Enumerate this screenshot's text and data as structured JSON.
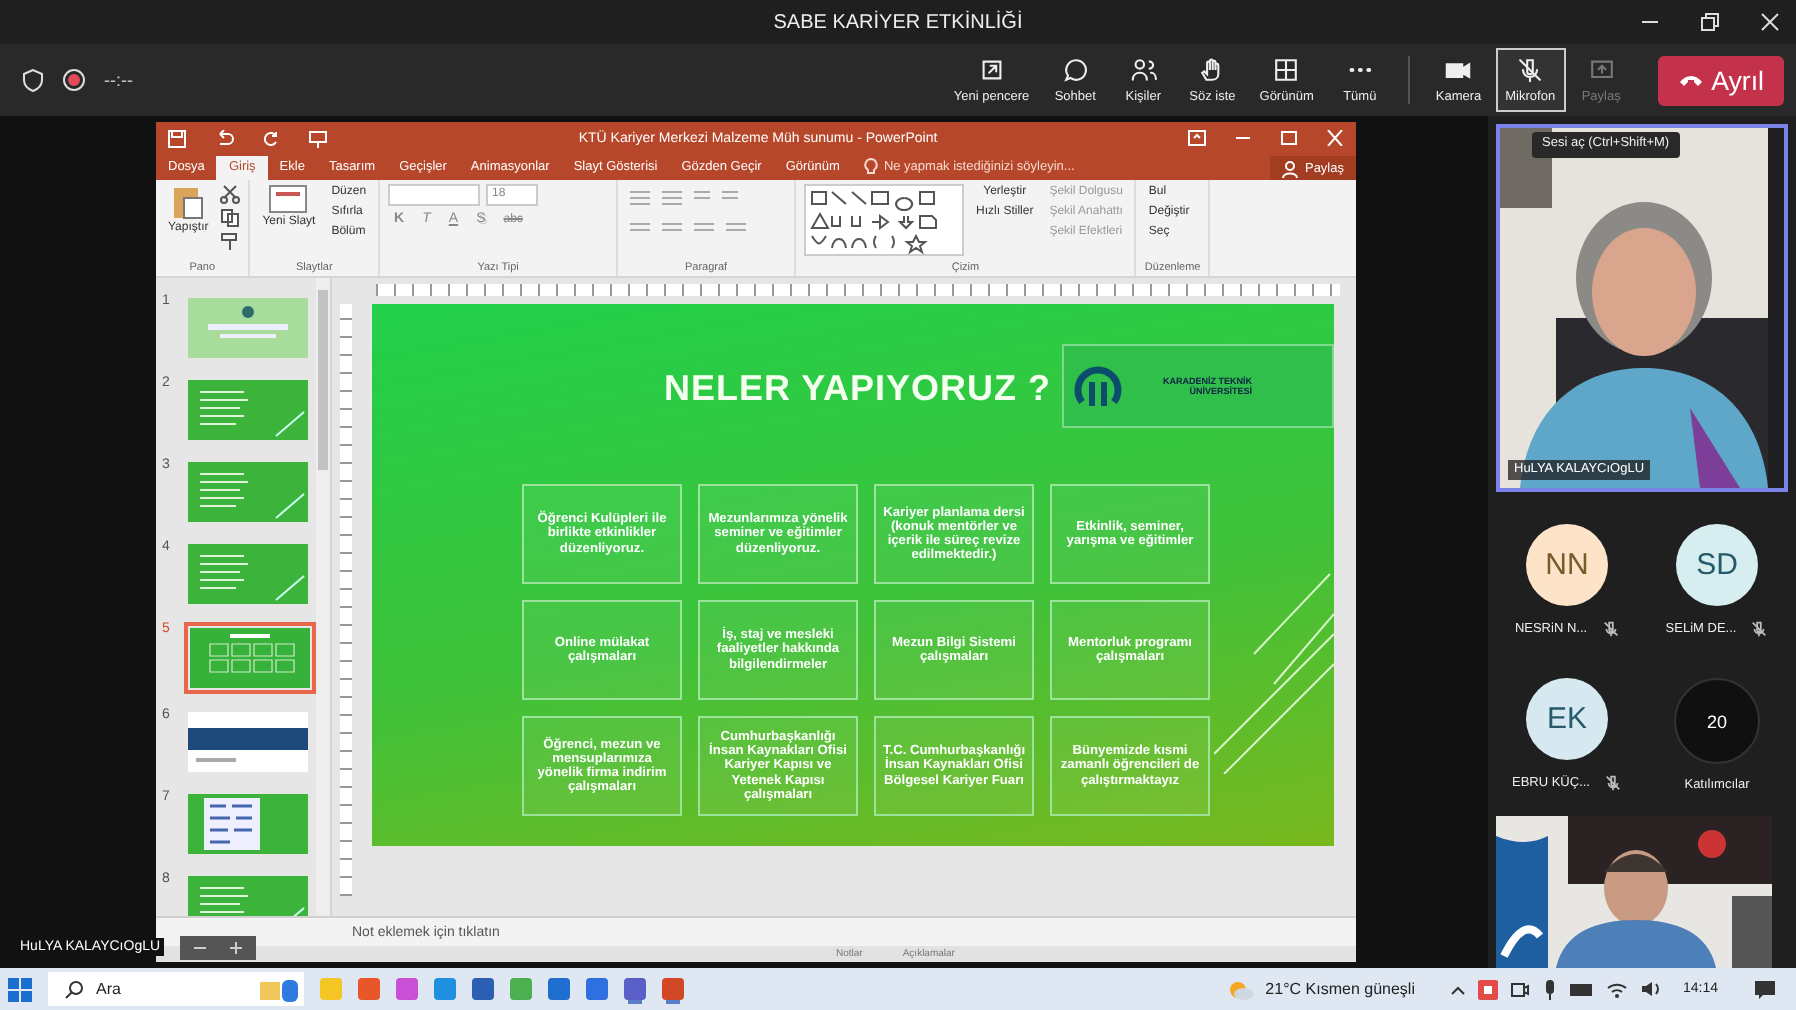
{
  "window": {
    "title": "SABE KARİYER ETKİNLİĞİ"
  },
  "meeting_bar": {
    "timer": "--:--",
    "recording": true,
    "leave": "Ayrıl",
    "buttons": [
      {
        "label": "Yeni pencere",
        "kind": "popout",
        "selected": false,
        "disabled": false
      },
      {
        "label": "Sohbet",
        "kind": "chat",
        "selected": false,
        "disabled": false
      },
      {
        "label": "Kişiler",
        "kind": "people",
        "selected": false,
        "disabled": false
      },
      {
        "label": "Söz iste",
        "kind": "hand",
        "selected": false,
        "disabled": false
      },
      {
        "label": "Görünüm",
        "kind": "grid",
        "selected": false,
        "disabled": false
      },
      {
        "label": "Tümü",
        "kind": "more",
        "selected": false,
        "disabled": false
      },
      {
        "label": "Kamera",
        "kind": "camera",
        "selected": false,
        "disabled": false
      },
      {
        "label": "Mikrofon",
        "kind": "mic",
        "selected": true,
        "disabled": false
      },
      {
        "label": "Paylaş",
        "kind": "share",
        "selected": false,
        "disabled": true
      }
    ]
  },
  "shared_screen": {
    "presenter": "HuLYA KALAYCıOgLU",
    "powerpoint": {
      "title": "KTÜ Kariyer Merkezi Malzeme Müh sunumu - PowerPoint",
      "tell_me": "Ne yapmak istediğinizi söyleyin...",
      "share": "Paylaş",
      "tabs": [
        {
          "label": "Dosya",
          "selected": false
        },
        {
          "label": "Giriş",
          "selected": true
        },
        {
          "label": "Ekle",
          "selected": false
        },
        {
          "label": "Tasarım",
          "selected": false
        },
        {
          "label": "Geçişler",
          "selected": false
        },
        {
          "label": "Animasyonlar",
          "selected": false
        },
        {
          "label": "Slayt Gösterisi",
          "selected": false
        },
        {
          "label": "Gözden Geçir",
          "selected": false
        },
        {
          "label": "Görünüm",
          "selected": false
        }
      ],
      "ribbon": [
        {
          "name": "Pano",
          "kind": "clipboard",
          "items": [
            "Yapıştır"
          ]
        },
        {
          "name": "Slaytlar",
          "kind": "slides",
          "items": [
            "Yeni Slayt",
            "Düzen",
            "Sıfırla",
            "Bölüm"
          ]
        },
        {
          "name": "Yazı Tipi",
          "kind": "font",
          "font_size": "18",
          "format_buttons": [
            "K",
            "T",
            "A",
            "S",
            "abc"
          ]
        },
        {
          "name": "Paragraf",
          "kind": "paragraph"
        },
        {
          "name": "Çizim",
          "kind": "drawing",
          "items": [
            "Yerleştir",
            "Hızlı Stiller",
            "Şekil Dolgusu",
            "Şekil Anahattı",
            "Şekil Efektleri"
          ]
        },
        {
          "name": "Düzenleme",
          "kind": "editing",
          "items": [
            "Bul",
            "Değiştir",
            "Seç"
          ]
        }
      ],
      "thumbnails": [
        {
          "number": "1",
          "kind": "title",
          "selected": false
        },
        {
          "number": "2",
          "kind": "green",
          "selected": false
        },
        {
          "number": "3",
          "kind": "green",
          "selected": false
        },
        {
          "number": "4",
          "kind": "green",
          "selected": false
        },
        {
          "number": "5",
          "kind": "grid",
          "selected": true
        },
        {
          "number": "6",
          "kind": "white",
          "selected": false
        },
        {
          "number": "7",
          "kind": "collage",
          "selected": false
        },
        {
          "number": "8",
          "kind": "green",
          "selected": false
        }
      ],
      "slide": {
        "title": "NELER YAPIYORUZ ?",
        "logo_text": "KARADENİZ TEKNİK ÜNİVERSİTESİ",
        "cards": [
          "Öğrenci Kulüpleri ile birlikte etkinlikler düzenliyoruz.",
          "Mezunlarımıza yönelik seminer ve eğitimler düzenliyoruz.",
          "Kariyer planlama dersi (konuk mentörler ve içerik ile süreç revize edilmektedir.)",
          "Etkinlik, seminer, yarışma ve eğitimler",
          "Online mülakat çalışmaları",
          "İş, staj ve mesleki faaliyetler hakkında bilgilendirmeler",
          "Mezun Bilgi Sistemi çalışmaları",
          "Mentorluk programı çalışmaları",
          "Öğrenci, mezun ve mensuplarımıza yönelik firma indirim çalışmaları",
          "Cumhurbaşkanlığı İnsan Kaynakları Ofisi Kariyer Kapısı ve Yetenek Kapısı çalışmaları",
          "T.C. Cumhurbaşkanlığı İnsan Kaynakları Ofisi Bölgesel Kariyer Fuarı",
          "Bünyemizde kısmi zamanlı öğrencileri de çalıştırmaktayız"
        ]
      },
      "notes_placeholder": "Not eklemek için tıklatın",
      "status": [
        "Notlar",
        "Açıklamalar"
      ]
    }
  },
  "people_panel": {
    "tooltip": "Sesi aç (Ctrl+Shift+M)",
    "speaker": "HuLYA KALAYCıOgLU",
    "participants": [
      {
        "initials": "NN",
        "name": "NESRiN N...",
        "color": "#fde3c8",
        "muted": true
      },
      {
        "initials": "SD",
        "name": "SELiM DE...",
        "color": "#d7eef0",
        "muted": true
      },
      {
        "initials": "EK",
        "name": "EBRU KÜÇ...",
        "color": "#d6e8f0",
        "muted": true
      }
    ],
    "more": {
      "count": "20",
      "label": "Katılımcılar"
    }
  },
  "taskbar": {
    "search": "Ara",
    "weather": "21°C Kısmen güneşli",
    "clock": "14:14"
  }
}
